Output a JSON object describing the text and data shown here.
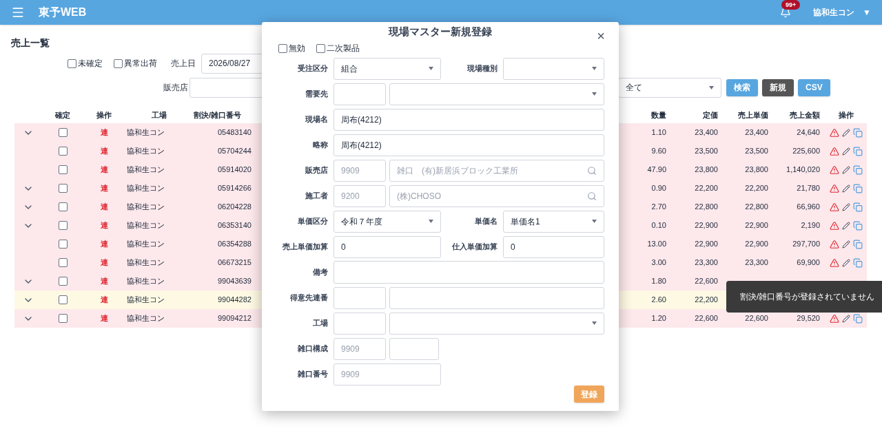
{
  "app_bar": {
    "title": "東予WEB",
    "notification_badge": "99+",
    "user": "協和生コン",
    "user_caret": "▼"
  },
  "page_title": "売上一覧",
  "filters": {
    "checkboxes": [
      {
        "label": "未確定",
        "checked": false
      },
      {
        "label": "異常出荷",
        "checked": false
      }
    ],
    "date_label": "売上日",
    "date_value": "2026/08/27",
    "shop_label": "販売店",
    "product_type_value": "全て",
    "buttons": [
      {
        "label": "検索",
        "kind": "primary"
      },
      {
        "label": "新規",
        "kind": "dark"
      },
      {
        "label": "CSV",
        "kind": "primary"
      }
    ]
  },
  "table": {
    "columns_left": [
      "確定",
      "操作",
      "工場",
      "割決/雑口番号"
    ],
    "columns_right": [
      "数量",
      "定価",
      "売上単価",
      "売上金額",
      "操作"
    ],
    "rows": [
      {
        "expandable": true,
        "color": "#fde8ec",
        "confirmed": false,
        "op": "連",
        "factory": "協和生コン",
        "number": "05483140",
        "qty": "1.10",
        "list_price": "23,400",
        "unit_price": "23,400",
        "amount": "24,640",
        "actions": true
      },
      {
        "expandable": false,
        "color": "#fde8ec",
        "confirmed": false,
        "op": "連",
        "factory": "協和生コン",
        "number": "05704244",
        "qty": "9.60",
        "list_price": "23,500",
        "unit_price": "23,500",
        "amount": "225,600",
        "actions": true
      },
      {
        "expandable": false,
        "color": "#fde8ec",
        "confirmed": false,
        "op": "連",
        "factory": "協和生コン",
        "number": "05914020",
        "qty": "47.90",
        "list_price": "23,800",
        "unit_price": "23,800",
        "amount": "1,140,020",
        "actions": true
      },
      {
        "expandable": true,
        "color": "#fde8ec",
        "confirmed": false,
        "op": "連",
        "factory": "協和生コン",
        "number": "05914266",
        "qty": "0.90",
        "list_price": "22,200",
        "unit_price": "22,200",
        "amount": "21,780",
        "actions": true
      },
      {
        "expandable": true,
        "color": "#fde8ec",
        "confirmed": false,
        "op": "連",
        "factory": "協和生コン",
        "number": "06204228",
        "qty": "2.70",
        "list_price": "22,800",
        "unit_price": "22,800",
        "amount": "66,960",
        "actions": true
      },
      {
        "expandable": true,
        "color": "#fde8ec",
        "confirmed": false,
        "op": "連",
        "factory": "協和生コン",
        "number": "06353140",
        "qty": "0.10",
        "list_price": "22,900",
        "unit_price": "22,900",
        "amount": "2,190",
        "actions": true
      },
      {
        "expandable": false,
        "color": "#fde8ec",
        "confirmed": false,
        "op": "連",
        "factory": "協和生コン",
        "number": "06354288",
        "qty": "13.00",
        "list_price": "22,900",
        "unit_price": "22,900",
        "amount": "297,700",
        "actions": true
      },
      {
        "expandable": false,
        "color": "#fde8ec",
        "confirmed": false,
        "op": "連",
        "factory": "協和生コン",
        "number": "06673215",
        "qty": "3.00",
        "list_price": "23,300",
        "unit_price": "23,300",
        "amount": "69,900",
        "actions": true
      },
      {
        "expandable": true,
        "color": "#fde8ec",
        "confirmed": false,
        "op": "連",
        "factory": "協和生コン",
        "number": "99043639",
        "qty": "1.80",
        "list_price": "22,600",
        "actions": false
      },
      {
        "expandable": true,
        "color": "#fdf9e3",
        "confirmed": false,
        "op": "連",
        "factory": "協和生コン",
        "number": "99044282",
        "qty": "2.60",
        "list_price": "22,200",
        "actions": false
      },
      {
        "expandable": true,
        "color": "#fde8ec",
        "confirmed": false,
        "op": "連",
        "factory": "協和生コン",
        "number": "99094212",
        "qty": "1.20",
        "list_price": "22,600",
        "unit_price": "22,600",
        "amount": "29,520",
        "actions": true
      }
    ]
  },
  "tooltip": "割決/雑口番号が登録されていません",
  "dialog": {
    "title": "現場マスター新規登録",
    "close": "×",
    "checkboxes": [
      {
        "label": "無効",
        "checked": false
      },
      {
        "label": "二次製品",
        "checked": false
      }
    ],
    "rows": [
      {
        "kind": "pair",
        "left": {
          "label": "受注区分",
          "value": "組合",
          "kind": "select"
        },
        "right": {
          "label": "現場種別",
          "kind": "select"
        }
      },
      {
        "kind": "split",
        "label": "需要先",
        "short": {},
        "long": {
          "kind": "select"
        }
      },
      {
        "kind": "wide",
        "label": "現場名",
        "value": "周布(4212)"
      },
      {
        "kind": "wide",
        "label": "略称",
        "value": "周布(4212)"
      },
      {
        "kind": "split",
        "label": "販売店",
        "short": {
          "value": "9909",
          "disabled": true
        },
        "long": {
          "value": "雑口　(有)新居浜ブロック工業所",
          "kind": "search",
          "disabled": true
        }
      },
      {
        "kind": "split",
        "label": "施工者",
        "short": {
          "value": "9200",
          "disabled": true
        },
        "long": {
          "value": "(株)CHOSO",
          "kind": "search",
          "disabled": true
        }
      },
      {
        "kind": "pair",
        "left": {
          "label": "単価区分",
          "value": "令和７年度",
          "kind": "select"
        },
        "right": {
          "label": "単価名",
          "value": "単価名1",
          "kind": "select"
        }
      },
      {
        "kind": "pair",
        "left": {
          "label": "売上単価加算",
          "value": "0",
          "kind": "text"
        },
        "right": {
          "label": "仕入単価加算",
          "value": "0",
          "kind": "text"
        }
      },
      {
        "kind": "textarea",
        "label": "備考"
      },
      {
        "kind": "split",
        "label": "得意先連番",
        "short": {},
        "long": {
          "kind": "text"
        }
      },
      {
        "kind": "split",
        "label": "工場",
        "short": {},
        "long": {
          "kind": "select"
        }
      },
      {
        "kind": "double",
        "label": "雑口構成",
        "first": {
          "value": "9909",
          "disabled": true
        },
        "second": {}
      },
      {
        "kind": "half",
        "label": "雑口番号",
        "value": "9909",
        "disabled": true
      }
    ],
    "submit": "登録"
  }
}
